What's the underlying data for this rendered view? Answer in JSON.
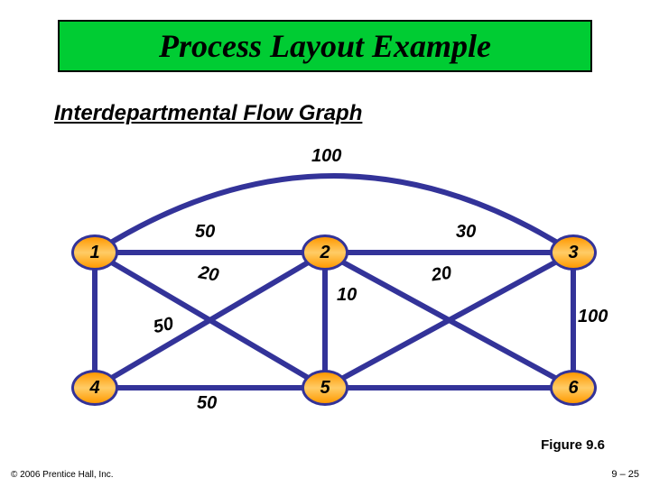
{
  "title": "Process Layout Example",
  "subtitle": "Interdepartmental Flow Graph",
  "nodes": {
    "n1": "1",
    "n2": "2",
    "n3": "3",
    "n4": "4",
    "n5": "5",
    "n6": "6"
  },
  "edge_labels": {
    "e13_top": "100",
    "e12": "50",
    "e23": "30",
    "e15": "20",
    "e25": "10",
    "e26": "20",
    "e14": "50",
    "e36": "100",
    "e45": "50"
  },
  "figure_label": "Figure 9.6",
  "copyright": "© 2006 Prentice Hall, Inc.",
  "page_number": "9 – 25",
  "chart_data": {
    "type": "graph",
    "title": "Interdepartmental Flow Graph",
    "nodes": [
      "1",
      "2",
      "3",
      "4",
      "5",
      "6"
    ],
    "edges": [
      {
        "from": "1",
        "to": "3",
        "weight": 100
      },
      {
        "from": "1",
        "to": "2",
        "weight": 50
      },
      {
        "from": "2",
        "to": "3",
        "weight": 30
      },
      {
        "from": "1",
        "to": "5",
        "weight": 20
      },
      {
        "from": "2",
        "to": "5",
        "weight": 10
      },
      {
        "from": "2",
        "to": "6",
        "weight": 20
      },
      {
        "from": "1",
        "to": "4",
        "weight": 50
      },
      {
        "from": "3",
        "to": "6",
        "weight": 100
      },
      {
        "from": "4",
        "to": "5",
        "weight": 50
      }
    ]
  }
}
